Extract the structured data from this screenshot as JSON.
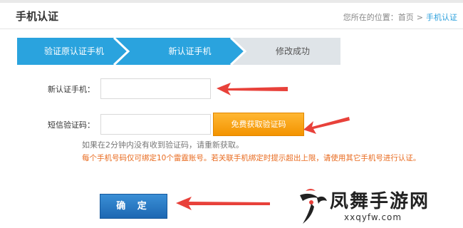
{
  "header": {
    "title": "手机认证",
    "breadcrumb": {
      "prefix": "您所在的位置：",
      "home": "首页",
      "separator": ">",
      "current": "手机认证"
    }
  },
  "steps": [
    {
      "label": "验证原认证手机",
      "state": "done"
    },
    {
      "label": "新认证手机",
      "state": "active"
    },
    {
      "label": "修改成功",
      "state": "pending"
    }
  ],
  "form": {
    "phone_label": "新认证手机：",
    "phone_value": "",
    "code_label": "短信验证码：",
    "code_value": "",
    "get_code_button": "免费获取验证码",
    "hint": "如果在2分钟内没有收到验证码，请重新获取。",
    "warning": "每个手机号码仅可绑定10个雷霆账号。若关联手机绑定时提示超出上限，请使用其它手机号进行认证。",
    "confirm_button": "确 定"
  },
  "watermark": {
    "name": "凤舞手游网",
    "url": "xxqyfw.com"
  },
  "colors": {
    "step_active": "#2aa3de",
    "step_pending": "#dfe4e8",
    "accent_orange": "#f5a000",
    "warning_text": "#e86a1e",
    "arrow_red": "#e8413a",
    "confirm_blue": "#1d67b2"
  },
  "icons": [
    "red-arrow-icon",
    "phoenix-logo-icon"
  ]
}
